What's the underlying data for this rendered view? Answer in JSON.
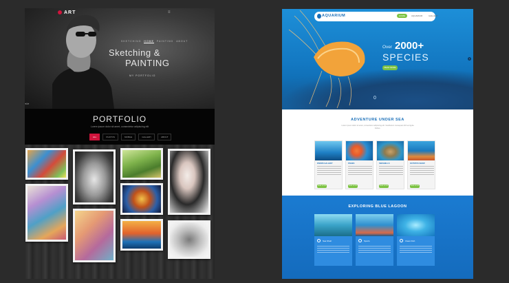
{
  "art": {
    "logo": "ART",
    "nav": [
      "SKETCHING",
      "HOME",
      "PAINTING",
      "ABOUT"
    ],
    "hero_title_line1": "Sketching &",
    "hero_title_line2": "PAINTING",
    "hero_link": "MY PORTFOLIO",
    "portfolio_title": "PORTFOLIO",
    "portfolio_subtitle": "Lorem ipsum dolor sit amet, consectetur adipiscing elit",
    "tabs": [
      {
        "label": "ALL"
      },
      {
        "label": "PHOTOS"
      },
      {
        "label": "MOBILE"
      },
      {
        "label": "GALLERY"
      },
      {
        "label": "ABOUT"
      }
    ]
  },
  "aqua": {
    "logo": "AQUARIUM",
    "nav": [
      "HOME",
      "AQUARIUM",
      "GALLERY"
    ],
    "hero_over": "Over",
    "hero_number": "2000+",
    "hero_species": "SPECIES",
    "hero_button": "READ MORE",
    "hero_counter": "0",
    "section1_title": "ADVENTURE UNDER SEA",
    "section1_sub": "Lorem ipsum dolor sit amet, consectetur adipiscing elit. Vestibulum consequat nibh ac ligula finibus.",
    "cards": [
      {
        "title": "DIVERS GALLERY",
        "more": "READ MORE"
      },
      {
        "title": "FISHES",
        "more": "READ MORE"
      },
      {
        "title": "SEESHELLS",
        "more": "READ MORE"
      },
      {
        "title": "OCTOPUS SHOW",
        "more": "READ MORE"
      }
    ],
    "section2_title": "EXPLORING BLUE LAGOON",
    "lagoon_cards": [
      {
        "title": "Sea Shell"
      },
      {
        "title": "Sports"
      },
      {
        "title": "Clean Fish"
      }
    ]
  }
}
